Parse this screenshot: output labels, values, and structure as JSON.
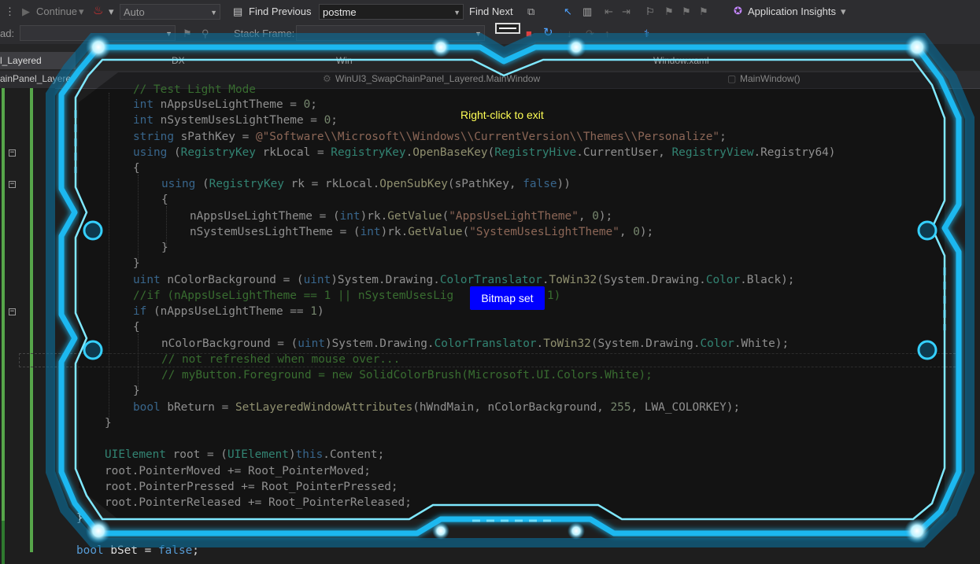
{
  "toolbar1": {
    "continue_label": "Continue",
    "auto_combo": "Auto",
    "find_previous_label": "Find Previous",
    "find_text": "postme",
    "find_next_label": "Find Next",
    "app_insights_label": "Application Insights"
  },
  "toolbar2": {
    "thread_label": "ad:",
    "stack_frame_label": "Stack Frame:"
  },
  "tabs": {
    "tab1": "l_Layered",
    "tab2": "DX",
    "tab3": "Win",
    "tab4": "Window.xaml"
  },
  "navbar": {
    "left": "ainPanel_Layere",
    "middle": "WinUI3_SwapChainPanel_Layered.MainWindow",
    "right": "MainWindow()"
  },
  "code": {
    "l0": "// Test Light Mode",
    "l1_kw": "int",
    "l1_rest": " nAppsUseLightTheme = ",
    "l1_num": "0",
    "l1_end": ";",
    "l2_kw": "int",
    "l2_rest": " nSystemUsesLightTheme = ",
    "l2_num": "0",
    "l2_end": ";",
    "l3_kw": "string",
    "l3_rest": " sPathKey = ",
    "l3_str": "@\"Software\\\\Microsoft\\\\Windows\\\\CurrentVersion\\\\Themes\\\\Personalize\"",
    "l3_end": ";",
    "l4_kw": "using",
    "l4_a": " (",
    "l4_ty": "RegistryKey",
    "l4_b": " rkLocal = ",
    "l4_ty2": "RegistryKey",
    "l4_c": ".",
    "l4_mt": "OpenBaseKey",
    "l4_d": "(",
    "l4_ty3": "RegistryHive",
    "l4_e": ".CurrentUser, ",
    "l4_ty4": "RegistryView",
    "l4_f": ".Registry64)",
    "l5": "{",
    "l6_kw": "using",
    "l6_a": " (",
    "l6_ty": "RegistryKey",
    "l6_b": " rk = rkLocal.",
    "l6_mt": "OpenSubKey",
    "l6_c": "(sPathKey, ",
    "l6_kw2": "false",
    "l6_d": "))",
    "l7": "{",
    "l8_a": "nAppsUseLightTheme = (",
    "l8_kw": "int",
    "l8_b": ")rk.",
    "l8_mt": "GetValue",
    "l8_c": "(",
    "l8_str": "\"AppsUseLightTheme\"",
    "l8_d": ", ",
    "l8_num": "0",
    "l8_e": ");",
    "l9_a": "nSystemUsesLightTheme = (",
    "l9_kw": "int",
    "l9_b": ")rk.",
    "l9_mt": "GetValue",
    "l9_c": "(",
    "l9_str": "\"SystemUsesLightTheme\"",
    "l9_d": ", ",
    "l9_num": "0",
    "l9_e": ");",
    "l10": "}",
    "l11": "}",
    "l12_kw": "uint",
    "l12_a": " nColorBackground = (",
    "l12_kw2": "uint",
    "l12_b": ")System.Drawing.",
    "l12_ty": "ColorTranslator",
    "l12_c": ".",
    "l12_mt": "ToWin32",
    "l12_d": "(System.Drawing.",
    "l12_ty2": "Color",
    "l12_e": ".Black);",
    "l13": "//if (nAppsUseLightTheme == 1 || nSystemUsesLig",
    "l13_tail": "1)",
    "l14_kw": "if",
    "l14_a": " (nAppsUseLightTheme == ",
    "l14_num": "1",
    "l14_b": ")",
    "l15": "{",
    "l16_a": "nColorBackground = (",
    "l16_kw": "uint",
    "l16_b": ")System.Drawing.",
    "l16_ty": "ColorTranslator",
    "l16_c": ".",
    "l16_mt": "ToWin32",
    "l16_d": "(System.Drawing.",
    "l16_ty2": "Color",
    "l16_e": ".White);",
    "l17": "// not refreshed when mouse over...",
    "l18": "// myButton.Foreground = new SolidColorBrush(Microsoft.UI.Colors.White);",
    "l19": "}",
    "l20_kw": "bool",
    "l20_a": " bReturn = ",
    "l20_mt": "SetLayeredWindowAttributes",
    "l20_b": "(hWndMain, nColorBackground, ",
    "l20_num": "255",
    "l20_c": ", LWA_COLORKEY);",
    "l21": "}",
    "l22_ty": "UIElement",
    "l22_a": " root = (",
    "l22_ty2": "UIElement",
    "l22_b": ")",
    "l22_kw": "this",
    "l22_c": ".Content;",
    "l23_a": "root.",
    "l23_b": "PointerMoved += Root_PointerMoved;",
    "l24_a": "root.",
    "l24_b": "PointerPressed += Root_PointerPressed;",
    "l25_a": "root.",
    "l25_b": "PointerReleased += Root_PointerReleased;",
    "l26": "}",
    "l27_kw": "bool",
    "l27_a": " bSet = ",
    "l27_kw2": "false",
    "l27_b": ";"
  },
  "overlay": {
    "exit_hint": "Right-click to exit",
    "bitmap_button": "Bitmap set",
    "frame_color": "#2ad4ff",
    "button_color": "#0000ff"
  }
}
